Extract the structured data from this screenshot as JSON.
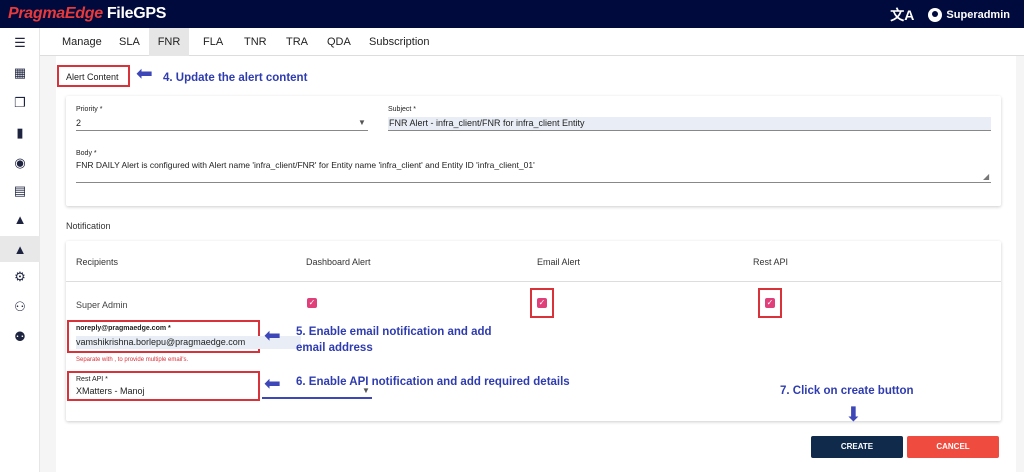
{
  "app": {
    "brand": "PragmaEdge",
    "product": "FileGPS",
    "user": "Superadmin"
  },
  "icons": {
    "translate": "translate-icon",
    "user": "account-circle-icon"
  },
  "sidebar": {
    "items": [
      {
        "icon": "menu-icon",
        "glyph": "☰"
      },
      {
        "icon": "dashboard-icon",
        "glyph": "▦"
      },
      {
        "icon": "files-icon",
        "glyph": "❐"
      },
      {
        "icon": "chart-icon",
        "glyph": "▮"
      },
      {
        "icon": "account-icon",
        "glyph": "◉"
      },
      {
        "icon": "document-icon",
        "glyph": "▤"
      },
      {
        "icon": "alert-icon",
        "glyph": "▲"
      },
      {
        "icon": "alert-settings-icon",
        "glyph": "▲"
      },
      {
        "icon": "gear-box-icon",
        "glyph": "⚙"
      },
      {
        "icon": "user-settings-icon",
        "glyph": "⚇"
      },
      {
        "icon": "group-icon",
        "glyph": "⚉"
      }
    ]
  },
  "tabs": [
    "Manage",
    "SLA",
    "FNR",
    "FLA",
    "TNR",
    "TRA",
    "QDA",
    "Subscription"
  ],
  "alert_content": {
    "section_label": "Alert Content",
    "annotation": "4. Update the alert content",
    "priority_label": "Priority *",
    "priority_value": "2",
    "subject_label": "Subject *",
    "subject_value": "FNR Alert - infra_client/FNR for infra_client Entity",
    "body_label": "Body *",
    "body_value": "FNR DAILY Alert is configured with Alert name 'infra_client/FNR' for Entity name 'infra_client' and Entity ID 'infra_client_01'"
  },
  "notification": {
    "section_label": "Notification",
    "headers": [
      "Recipients",
      "Dashboard Alert",
      "Email Alert",
      "Rest API"
    ],
    "row": {
      "recipient": "Super Admin",
      "dashboard": true,
      "email": true,
      "rest_api": true
    },
    "email_label": "noreply@pragmaedge.com *",
    "email_value": "vamshikrishna.borlepu@pragmaedge.com",
    "email_helper": "Separate with , to provide multiple email's.",
    "email_annotation_line1": "5. Enable email notification and add",
    "email_annotation_line2": "email address",
    "rest_label": "Rest API *",
    "rest_value": "XMatters - Manoj",
    "rest_annotation": "6. Enable API notification and add required details"
  },
  "actions": {
    "create_annotation": "7. Click on create button",
    "create_label": "CREATE",
    "cancel_label": "CANCEL"
  },
  "colors": {
    "topbar": "#000a3d",
    "brand_red": "#e83a3a",
    "checkbox": "#e0407a",
    "create_btn": "#0f2a4a",
    "cancel_btn": "#f04b3f",
    "annotation": "#2e3cb0",
    "highlight": "#d8323a"
  }
}
